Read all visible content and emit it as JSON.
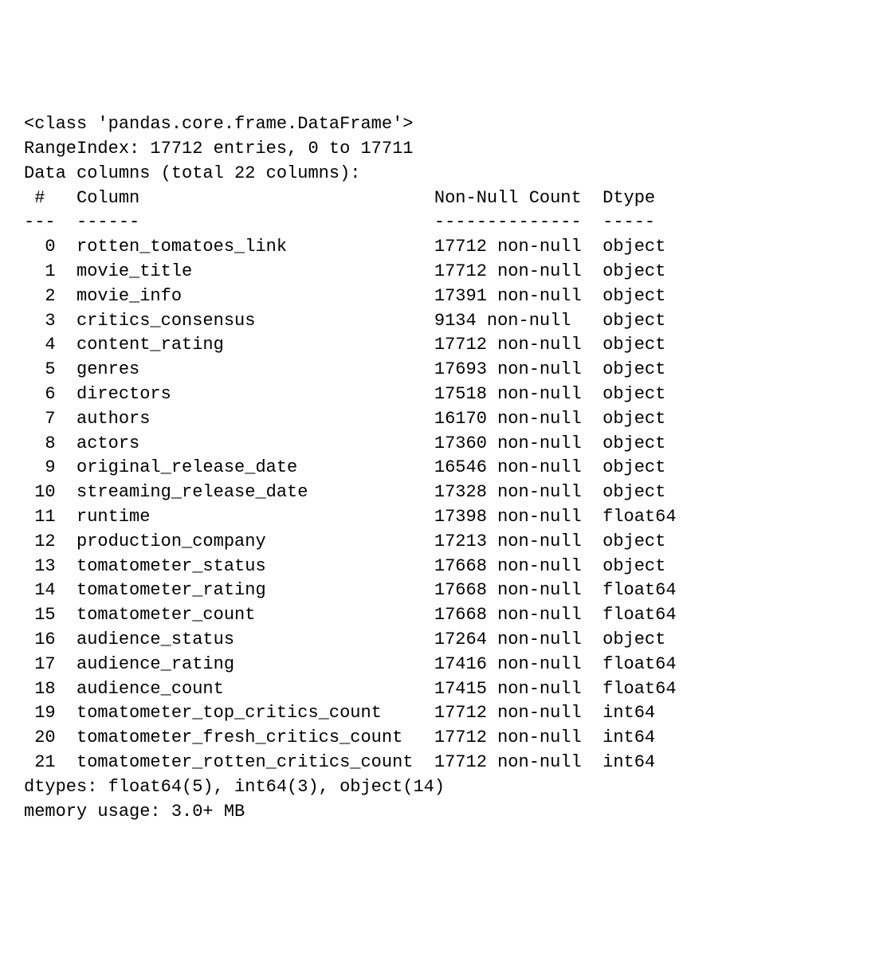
{
  "class_line": "<class 'pandas.core.frame.DataFrame'>",
  "range_index": "RangeIndex: 17712 entries, 0 to 17711",
  "data_columns_header": "Data columns (total 22 columns):",
  "headers": {
    "idx": "#",
    "col": "Column",
    "nn": "Non-Null Count",
    "dtype": "Dtype"
  },
  "dividers": {
    "idx": "---",
    "col": "------",
    "nn": "--------------",
    "dtype": "-----"
  },
  "columns": [
    {
      "idx": "0",
      "name": "rotten_tomatoes_link",
      "nn": "17712 non-null",
      "dtype": "object"
    },
    {
      "idx": "1",
      "name": "movie_title",
      "nn": "17712 non-null",
      "dtype": "object"
    },
    {
      "idx": "2",
      "name": "movie_info",
      "nn": "17391 non-null",
      "dtype": "object"
    },
    {
      "idx": "3",
      "name": "critics_consensus",
      "nn": "9134 non-null",
      "dtype": "object"
    },
    {
      "idx": "4",
      "name": "content_rating",
      "nn": "17712 non-null",
      "dtype": "object"
    },
    {
      "idx": "5",
      "name": "genres",
      "nn": "17693 non-null",
      "dtype": "object"
    },
    {
      "idx": "6",
      "name": "directors",
      "nn": "17518 non-null",
      "dtype": "object"
    },
    {
      "idx": "7",
      "name": "authors",
      "nn": "16170 non-null",
      "dtype": "object"
    },
    {
      "idx": "8",
      "name": "actors",
      "nn": "17360 non-null",
      "dtype": "object"
    },
    {
      "idx": "9",
      "name": "original_release_date",
      "nn": "16546 non-null",
      "dtype": "object"
    },
    {
      "idx": "10",
      "name": "streaming_release_date",
      "nn": "17328 non-null",
      "dtype": "object"
    },
    {
      "idx": "11",
      "name": "runtime",
      "nn": "17398 non-null",
      "dtype": "float64"
    },
    {
      "idx": "12",
      "name": "production_company",
      "nn": "17213 non-null",
      "dtype": "object"
    },
    {
      "idx": "13",
      "name": "tomatometer_status",
      "nn": "17668 non-null",
      "dtype": "object"
    },
    {
      "idx": "14",
      "name": "tomatometer_rating",
      "nn": "17668 non-null",
      "dtype": "float64"
    },
    {
      "idx": "15",
      "name": "tomatometer_count",
      "nn": "17668 non-null",
      "dtype": "float64"
    },
    {
      "idx": "16",
      "name": "audience_status",
      "nn": "17264 non-null",
      "dtype": "object"
    },
    {
      "idx": "17",
      "name": "audience_rating",
      "nn": "17416 non-null",
      "dtype": "float64"
    },
    {
      "idx": "18",
      "name": "audience_count",
      "nn": "17415 non-null",
      "dtype": "float64"
    },
    {
      "idx": "19",
      "name": "tomatometer_top_critics_count",
      "nn": "17712 non-null",
      "dtype": "int64"
    },
    {
      "idx": "20",
      "name": "tomatometer_fresh_critics_count",
      "nn": "17712 non-null",
      "dtype": "int64"
    },
    {
      "idx": "21",
      "name": "tomatometer_rotten_critics_count",
      "nn": "17712 non-null",
      "dtype": "int64"
    }
  ],
  "dtypes_summary": "dtypes: float64(5), int64(3), object(14)",
  "memory_usage": "memory usage: 3.0+ MB",
  "widths": {
    "idxCol": 5,
    "nameCol": 34,
    "nnCol": 16
  }
}
